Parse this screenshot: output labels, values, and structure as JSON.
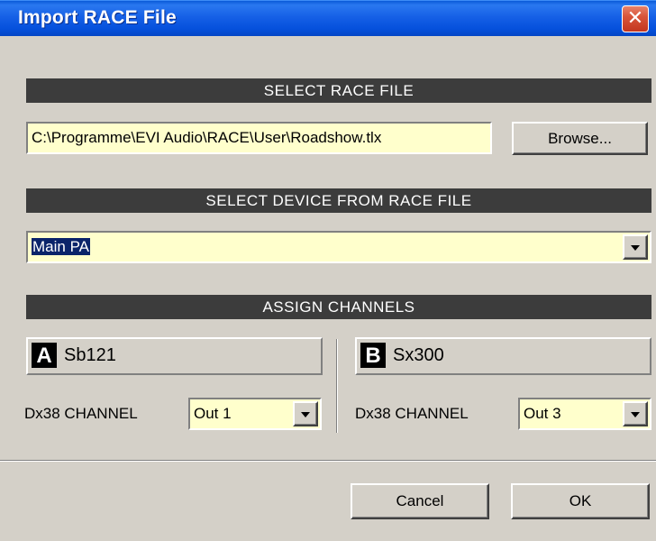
{
  "window": {
    "title": "Import RACE File",
    "close_symbol": "✕"
  },
  "race_file": {
    "header": "SELECT RACE FILE",
    "path": "C:\\Programme\\EVI Audio\\RACE\\User\\Roadshow.tlx",
    "browse_label": "Browse..."
  },
  "device": {
    "header": "SELECT DEVICE FROM RACE FILE",
    "selected": "Main PA"
  },
  "channels": {
    "header": "ASSIGN CHANNELS",
    "a": {
      "badge": "A",
      "name": "Sb121",
      "label": "Dx38 CHANNEL",
      "output": "Out 1"
    },
    "b": {
      "badge": "B",
      "name": "Sx300",
      "label": "Dx38 CHANNEL",
      "output": "Out 3"
    }
  },
  "footer": {
    "cancel_label": "Cancel",
    "ok_label": "OK"
  },
  "colors": {
    "dialog_bg": "#d4d0c8",
    "title_bar": "#0550dc",
    "section_header": "#3c3c3c",
    "field_bg": "#ffffcc",
    "selection": "#0a246a",
    "close_button": "#d9553a"
  },
  "icons": {
    "dropdown": "chevron-down-icon",
    "close": "close-icon"
  }
}
